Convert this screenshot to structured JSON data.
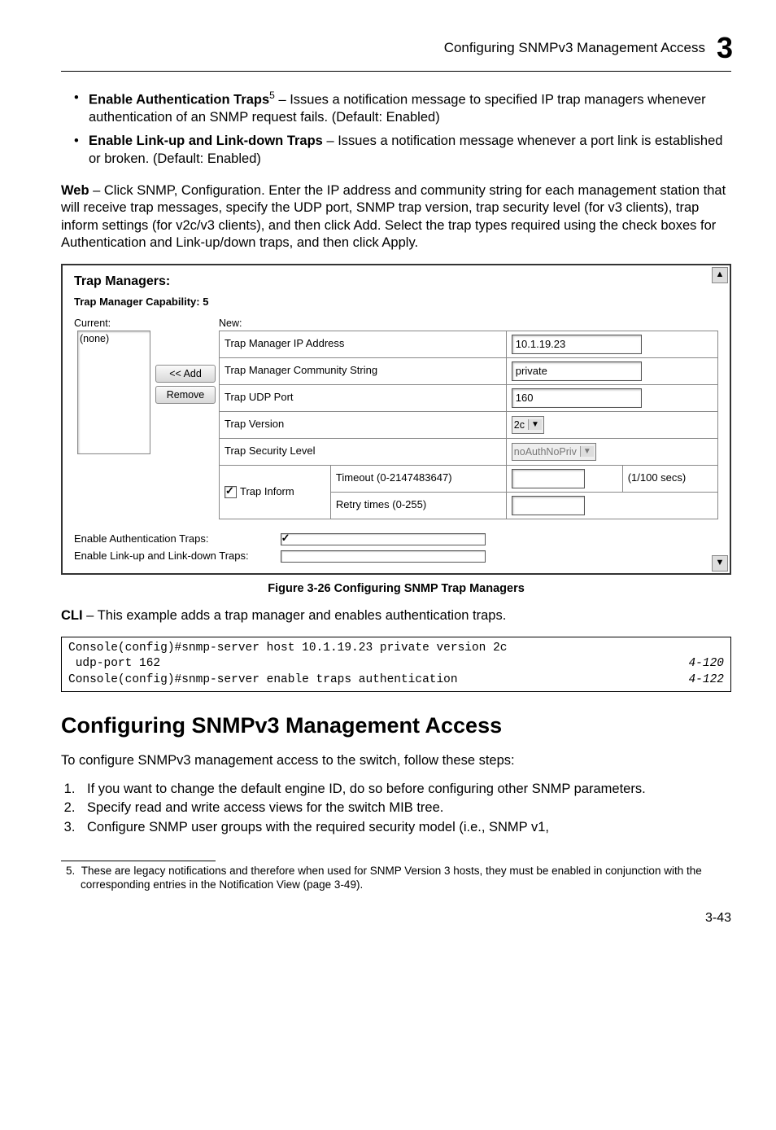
{
  "header": {
    "running_head": "Configuring SNMPv3 Management Access",
    "chapter_number": "3"
  },
  "bullets": [
    {
      "lead": "Enable Authentication Traps",
      "sup": "5",
      "rest": " – Issues a notification message to specified IP trap managers whenever authentication of an SNMP request fails. (Default: Enabled)"
    },
    {
      "lead": "Enable Link-up and Link-down Traps",
      "sup": "",
      "rest": " – Issues a notification message whenever a port link is established or broken. (Default: Enabled)"
    }
  ],
  "web_para_lead": "Web",
  "web_para_rest": " – Click SNMP, Configuration. Enter the IP address and community string for each management station that will receive trap messages, specify the UDP port, SNMP trap version, trap security level (for v3 clients), trap inform settings (for v2c/v3 clients), and then click Add. Select the trap types required using the check boxes for Authentication and Link-up/down traps, and then click Apply.",
  "figure": {
    "title": "Trap Managers:",
    "subtitle": "Trap Manager Capability: 5",
    "current_label": "Current:",
    "new_label": "New:",
    "listbox_value": "(none)",
    "btn_add": "<< Add",
    "btn_remove": "Remove",
    "rows": {
      "ip_label": "Trap Manager IP Address",
      "ip_value": "10.1.19.23",
      "community_label": "Trap Manager Community String",
      "community_value": "private",
      "udp_label": "Trap UDP Port",
      "udp_value": "160",
      "version_label": "Trap Version",
      "version_value": "2c",
      "security_label": "Trap Security Level",
      "security_value": "noAuthNoPriv",
      "inform_label": "Trap Inform",
      "timeout_label": "Timeout (0-2147483647)",
      "timeout_units": "(1/100 secs)",
      "retry_label": "Retry times (0-255)"
    },
    "check_auth_label": "Enable Authentication Traps:",
    "check_link_label": "Enable Link-up and Link-down Traps:"
  },
  "figure_caption": "Figure 3-26  Configuring SNMP Trap Managers",
  "cli_para_lead": "CLI",
  "cli_para_rest": " – This example adds a trap manager and enables authentication traps.",
  "code": {
    "line1_left": "Console(config)#snmp-server host 10.1.19.23 private version 2c",
    "line2_left": " udp-port 162",
    "line2_right": "4-120",
    "line3_left": "Console(config)#snmp-server enable traps authentication",
    "line3_right": "4-122"
  },
  "section_title": "Configuring SNMPv3 Management Access",
  "section_intro": "To configure SNMPv3 management access to the switch, follow these steps:",
  "steps": [
    "If you want to change the default engine ID, do so before configuring other SNMP parameters.",
    "Specify read and write access views for the switch MIB tree.",
    "Configure SNMP user groups with the required security model (i.e., SNMP v1,"
  ],
  "footnote_num": "5.",
  "footnote_text": "These are legacy notifications and therefore when used for SNMP Version 3 hosts, they must be enabled in conjunction with the corresponding entries in the Notification View (page 3-49).",
  "page_number": "3-43"
}
